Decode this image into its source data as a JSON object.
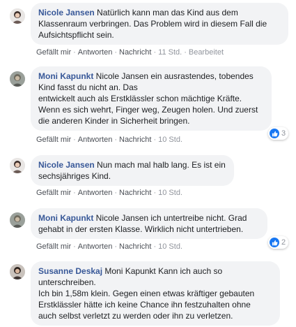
{
  "comments": [
    {
      "author": "Nicole Jansen",
      "text": " Natürlich kann man das Kind aus dem\nKlassenraum verbringen. Das Problem wird in diesem Fall die\nAufsichtspflicht sein.",
      "actions": [
        "Gefällt mir",
        "Antworten",
        "Nachricht",
        "11 Std.",
        "Bearbeitet"
      ],
      "avatar": "nicole-avatar"
    },
    {
      "author": "Moni Kapunkt",
      "text": " Nicole Jansen ein ausrastendes, tobendes\nKind fasst du nicht an. Das\nentwickelt auch als Erstklässler schon mächtige Kräfte.\nWenn es sich wehrt, Finger weg, Zeugen holen. Und zuerst\ndie anderen Kinder in Sicherheit bringen.",
      "actions": [
        "Gefällt mir",
        "Antworten",
        "Nachricht",
        "10 Std."
      ],
      "reaction_count": "3",
      "avatar": "moni-avatar"
    },
    {
      "author": "Nicole Jansen",
      "text": " Nun mach mal halb lang. Es ist ein\nsechsjähriges Kind.",
      "actions": [
        "Gefällt mir",
        "Antworten",
        "Nachricht",
        "10 Std."
      ],
      "avatar": "nicole-avatar"
    },
    {
      "author": "Moni Kapunkt",
      "text": " Nicole Jansen ich untertreibe nicht. Grad\ngehabt in der ersten Klasse. Wirklich nicht untertrieben.",
      "actions": [
        "Gefällt mir",
        "Antworten",
        "Nachricht",
        "10 Std."
      ],
      "reaction_count": "2",
      "avatar": "moni-avatar"
    },
    {
      "author": "Susanne Deskaj",
      "text": " Moni Kapunkt Kann ich auch so\nunterschreiben.\nIch bin 1,58m klein. Gegen einen etwas kräftiger gebauten\nErstklässler hätte ich keine Chance ihn festzuhalten ohne\nauch selbst verletzt zu werden oder ihn zu verletzen.",
      "avatar": "susanne-avatar"
    }
  ],
  "colors": {
    "author": "#385898",
    "bubble": "#f2f3f5",
    "meta": "#90949c",
    "like": "#1877f2"
  },
  "icons": {
    "reaction": "thumbs-up-icon"
  }
}
